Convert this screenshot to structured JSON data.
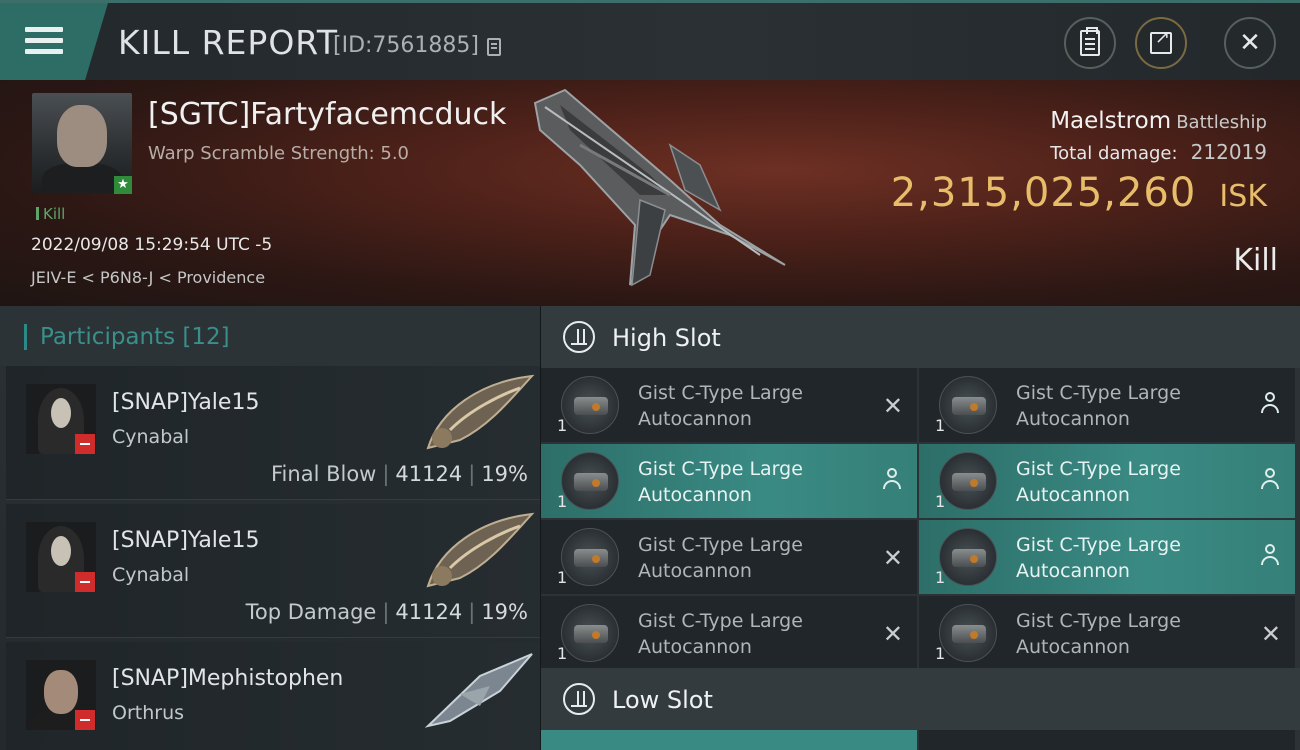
{
  "header": {
    "title": "KILL REPORT",
    "report_id": "[ID:7561885]"
  },
  "victim": {
    "name": "[SGTC]Fartyfacemcduck",
    "warp_scramble": "Warp Scramble Strength: 5.0",
    "kill_tag": "Kill",
    "timestamp": "2022/09/08 15:29:54 UTC -5",
    "location": "JEIV-E < P6N8-J < Providence",
    "ship_name": "Maelstrom",
    "ship_class": "Battleship",
    "total_damage_label": "Total damage:",
    "total_damage": "212019",
    "isk_value": "2,315,025,260",
    "isk_unit": "ISK",
    "outcome": "Kill"
  },
  "participants": {
    "title": "Participants [12]",
    "rows": [
      {
        "name": "[SNAP]Yale15",
        "ship": "Cynabal",
        "tag": "Final Blow",
        "damage": "41124",
        "percent": "19%"
      },
      {
        "name": "[SNAP]Yale15",
        "ship": "Cynabal",
        "tag": "Top Damage",
        "damage": "41124",
        "percent": "19%"
      },
      {
        "name": "[SNAP]Mephistophen",
        "ship": "Orthrus"
      }
    ]
  },
  "fitting": {
    "high_slot_label": "High Slot",
    "low_slot_label": "Low Slot",
    "modules": [
      {
        "line1": "Gist C-Type Large",
        "line2": "Autocannon",
        "qty": "1",
        "state": "destroyed",
        "highlight": false
      },
      {
        "line1": "Gist C-Type Large",
        "line2": "Autocannon",
        "qty": "1",
        "state": "dropped",
        "highlight": false
      },
      {
        "line1": "Gist C-Type Large",
        "line2": "Autocannon",
        "qty": "1",
        "state": "dropped",
        "highlight": true
      },
      {
        "line1": "Gist C-Type Large",
        "line2": "Autocannon",
        "qty": "1",
        "state": "dropped",
        "highlight": true
      },
      {
        "line1": "Gist C-Type Large",
        "line2": "Autocannon",
        "qty": "1",
        "state": "destroyed",
        "highlight": false
      },
      {
        "line1": "Gist C-Type Large",
        "line2": "Autocannon",
        "qty": "1",
        "state": "dropped",
        "highlight": true
      },
      {
        "line1": "Gist C-Type Large",
        "line2": "Autocannon",
        "qty": "1",
        "state": "destroyed",
        "highlight": false
      },
      {
        "line1": "Gist C-Type Large",
        "line2": "Autocannon",
        "qty": "1",
        "state": "destroyed",
        "highlight": false
      }
    ],
    "destroyed_glyph": "✕"
  },
  "colors": {
    "accent_teal": "#2e6d66",
    "isk_gold": "#e8bd6a",
    "kill_green": "#5ea56a",
    "badge_red": "#d12c2c"
  },
  "icons": [
    "menu-icon",
    "copy-icon",
    "clipboard-icon",
    "share-icon",
    "close-icon",
    "high-slot-icon",
    "low-slot-icon",
    "autocannon-icon",
    "person-icon",
    "x-icon"
  ]
}
